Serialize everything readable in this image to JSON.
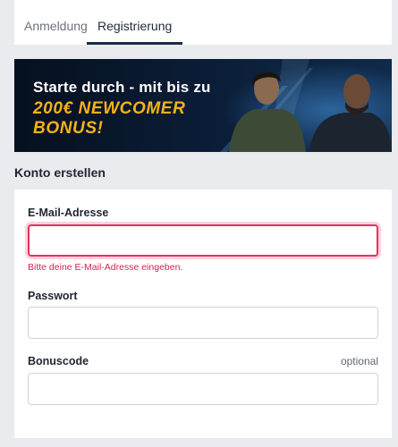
{
  "tabs": {
    "login_label": "Anmeldung",
    "register_label": "Registrierung",
    "active": "Registrierung"
  },
  "banner": {
    "line1": "Starte durch - mit bis zu",
    "line2": "200€ NEWCOMER",
    "line3": "BONUS!",
    "accent_color": "#f5b21b"
  },
  "section": {
    "title": "Konto erstellen"
  },
  "form": {
    "email": {
      "label": "E-Mail-Adresse",
      "value": "",
      "error": "Bitte deine E-Mail-Adresse eingeben."
    },
    "password": {
      "label": "Passwort",
      "value": ""
    },
    "bonuscode": {
      "label": "Bonuscode",
      "optional_label": "optional",
      "value": ""
    }
  },
  "colors": {
    "error": "#e4325f",
    "active_tab_underline": "#1a2b4a",
    "page_background": "#e9ebee"
  }
}
